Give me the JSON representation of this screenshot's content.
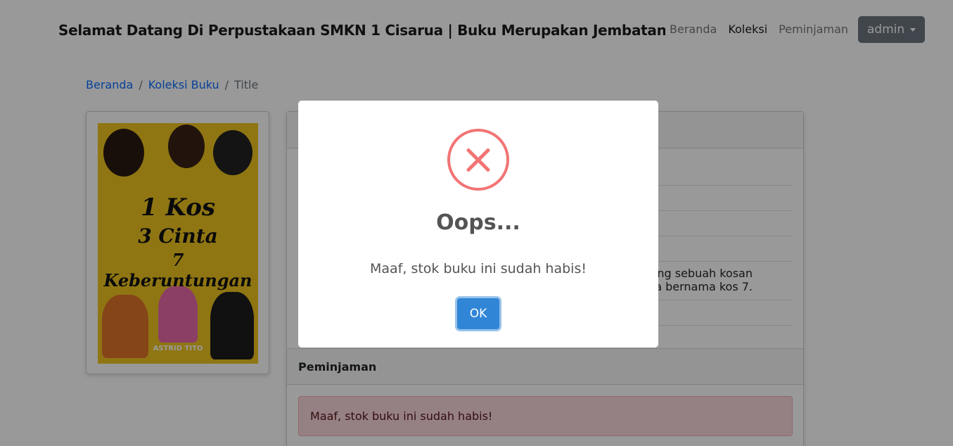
{
  "navbar": {
    "brand": "Selamat Datang Di Perpustakaan SMKN 1 Cisarua | Buku Merupakan Jembatan Ilmu",
    "links": [
      "Beranda",
      "Koleksi",
      "Peminjaman"
    ],
    "active_link": "Koleksi",
    "user_menu": "admin"
  },
  "breadcrumb": {
    "home": "Beranda",
    "collection": "Koleksi Buku",
    "current": "Title"
  },
  "book": {
    "cover_title_line1": "1 Kos",
    "cover_title_line2": "3 Cinta",
    "cover_title_line3": "7 Keberuntungan",
    "cover_author": "ASTRID TITO",
    "description_visible_line1": "tang sebuah kosan",
    "description_visible_line2": "a bernama kos 7."
  },
  "loan_section": {
    "header": "Peminjaman",
    "alert": "Maaf, stok buku ini sudah habis!"
  },
  "dialog": {
    "title": "Oops...",
    "message": "Maaf, stok buku ini sudah habis!",
    "confirm_label": "OK"
  },
  "colors": {
    "error_icon": "#f27474",
    "confirm_button": "#3085d6",
    "alert_bg": "#f8d7da",
    "user_button": "#6c757d"
  }
}
